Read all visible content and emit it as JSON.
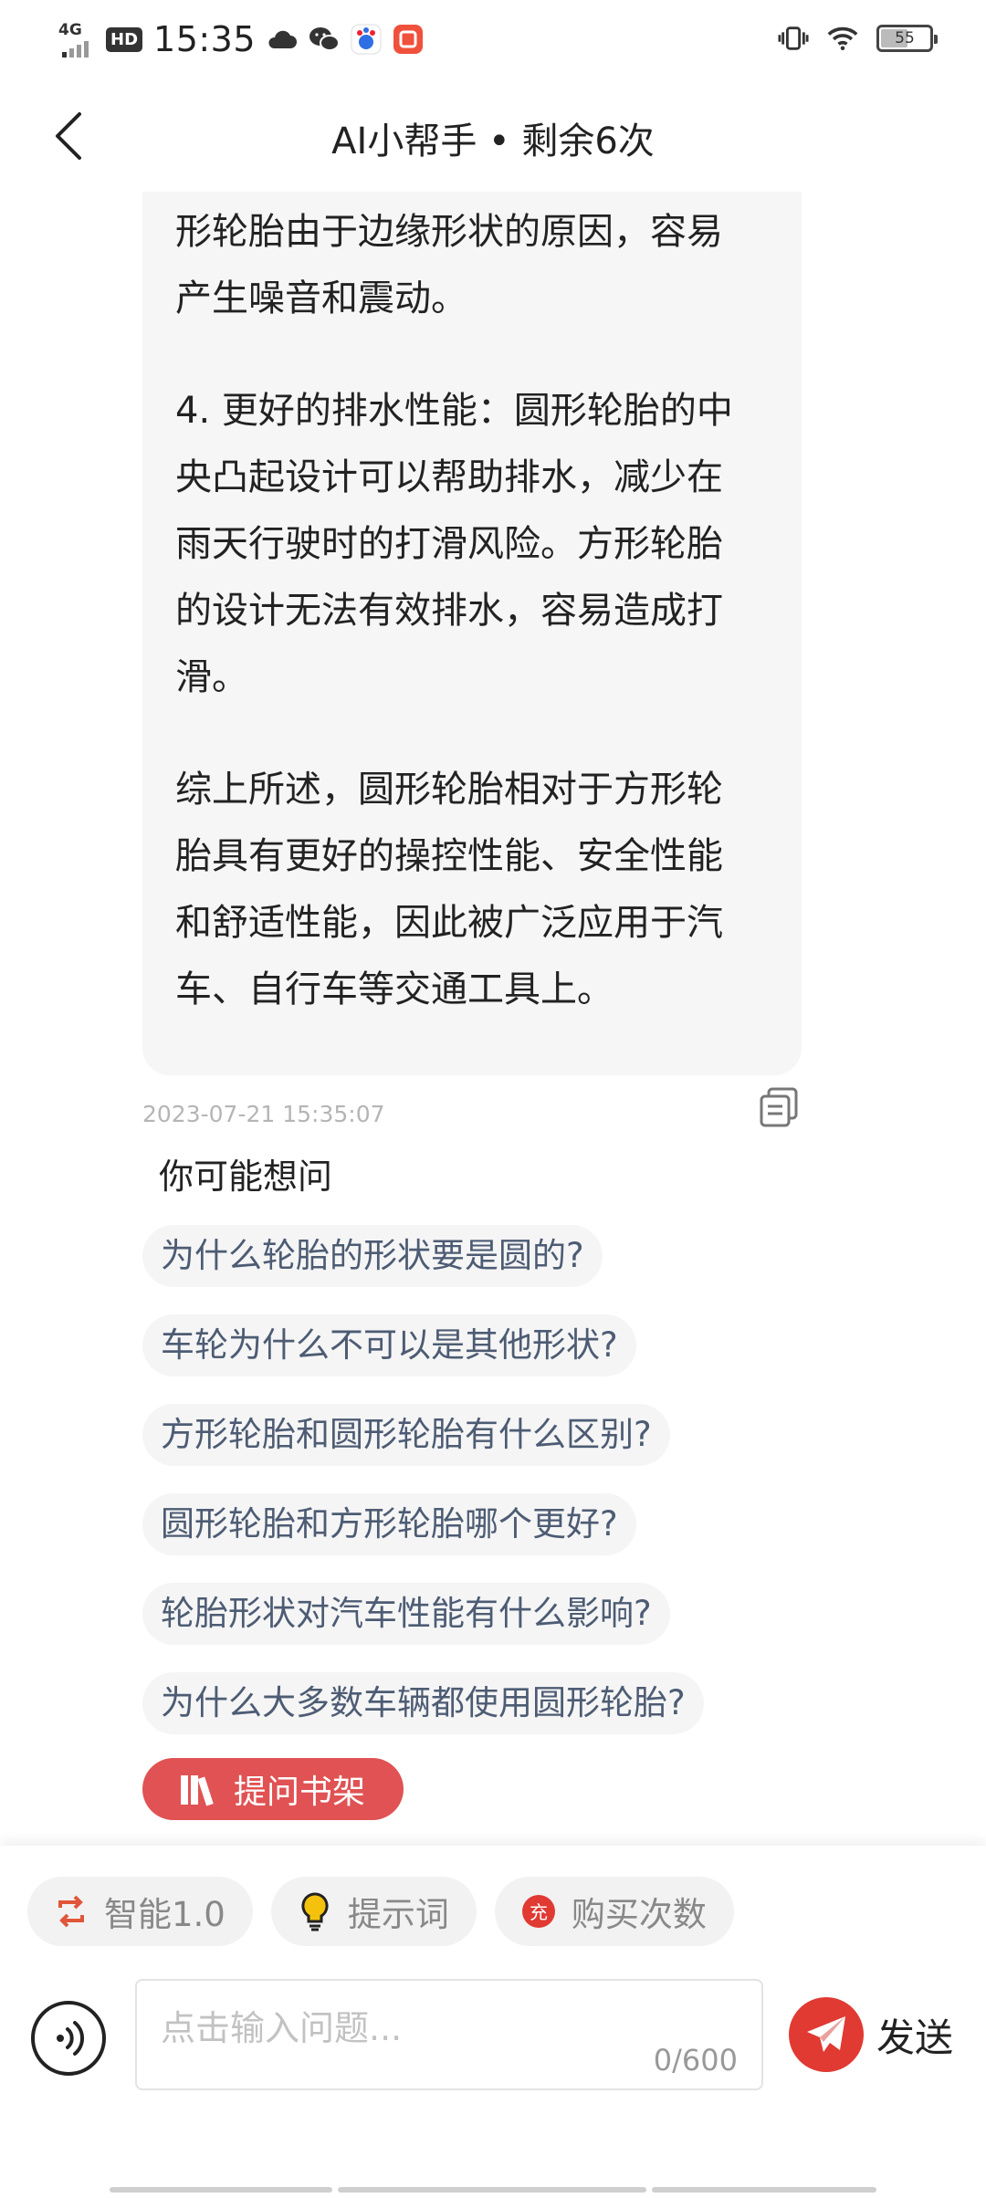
{
  "status_bar": {
    "network": "4G",
    "hd": "HD",
    "time": "15:35",
    "battery": "55",
    "battery_level": 0.55
  },
  "header": {
    "title": "AI小帮手 • 剩余6次"
  },
  "answer": {
    "paragraphs": [
      "形轮胎由于边缘形状的原因，容易\n产生噪音和震动。",
      "4. 更好的排水性能：圆形轮胎的中\n央凸起设计可以帮助排水，减少在\n雨天行驶时的打滑风险。方形轮胎\n的设计无法有效排水，容易造成打\n滑。",
      "综上所述，圆形轮胎相对于方形轮\n胎具有更好的操控性能、安全性能\n和舒适性能，因此被广泛应用于汽\n车、自行车等交通工具上。"
    ],
    "timestamp": "2023-07-21 15:35:07"
  },
  "suggestions": {
    "title": "你可能想问",
    "items": [
      "为什么轮胎的形状要是圆的?",
      "车轮为什么不可以是其他形状?",
      "方形轮胎和圆形轮胎有什么区别?",
      "圆形轮胎和方形轮胎哪个更好?",
      "轮胎形状对汽车性能有什么影响?",
      "为什么大多数车辆都使用圆形轮胎?"
    ]
  },
  "shelf_button": "提问书架",
  "toolbar": {
    "model": "智能1.0",
    "prompts": "提示词",
    "buy_badge": "充",
    "buy": "购买次数"
  },
  "composer": {
    "placeholder": "点击输入问题...",
    "value": "",
    "counter": "0/600",
    "send": "发送"
  },
  "colors": {
    "accent_red": "#e03a33",
    "shelf_red": "#e05253",
    "chip_text": "#4d5c74"
  }
}
